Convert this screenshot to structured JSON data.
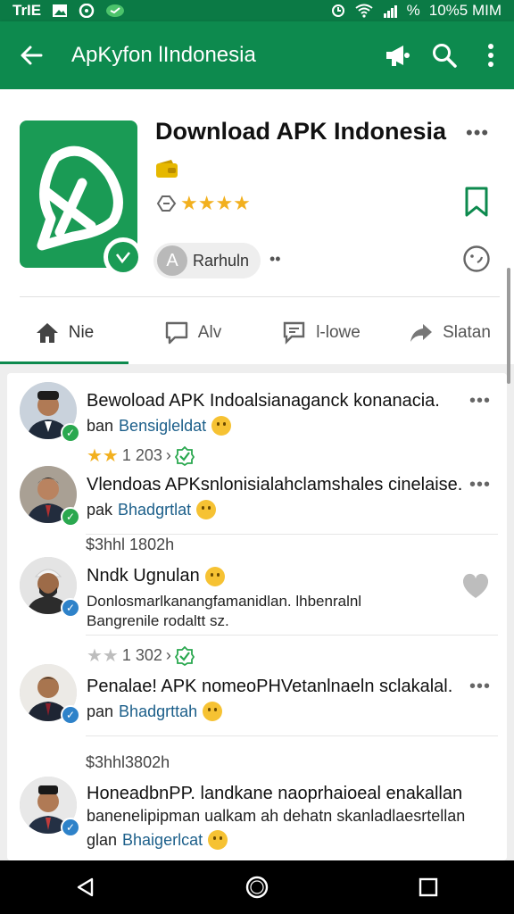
{
  "status_bar": {
    "carrier": "TrIE",
    "battery_time": "10%5 MIM",
    "percent_glyph": "%"
  },
  "toolbar": {
    "title": "ApKyfon lIndonesia"
  },
  "app": {
    "name": "Download APK Indonesia",
    "stars": "★★★★",
    "author_initial": "A",
    "author_label": "Rarhuln",
    "more": "•••",
    "dots": "••"
  },
  "tabs": [
    {
      "label": "Nie",
      "icon": "home-icon"
    },
    {
      "label": "Alv",
      "icon": "comment-icon"
    },
    {
      "label": "l-lowe",
      "icon": "chat-icon"
    },
    {
      "label": "Slatan",
      "icon": "share-icon"
    }
  ],
  "posts": [
    {
      "title": "Bewoload APK Indoalsianaganck konanacia.",
      "prefix": "ban",
      "handle": "Bensigleldat",
      "rating_text": "1 203",
      "more": "•••"
    },
    {
      "title": "Vlendoas APKsnlonisialahclamshales cinelaise.",
      "prefix": "pak",
      "handle": "Bhadgrtlat",
      "time": "$3hhl 1802h",
      "more": "•••"
    },
    {
      "title": "Nndk Ugnulan",
      "body1": "Donlosmarlkanangfamanidlan. lhbenralnl",
      "body2": "Bangrenile rodaltt sz.",
      "rating_text": "1 302"
    },
    {
      "title": "Penalae! APK nomeoPHVetanlnaeln sclakalal.",
      "prefix": "pan",
      "handle": "Bhadgrttah",
      "time": "$3hhl3802h",
      "more": "•••"
    },
    {
      "title": "HoneadbnPP. landkane naoprhaioeal enakallan",
      "body1": "banenelipipman ualkam ah dehatn skanladlaesrtellan",
      "prefix": "glan",
      "handle": "Bhaigerlcat"
    }
  ],
  "colors": {
    "primary": "#0d8a4e",
    "status": "#0b7a45",
    "star": "#f2b01e",
    "handle": "#1c5f8a"
  }
}
